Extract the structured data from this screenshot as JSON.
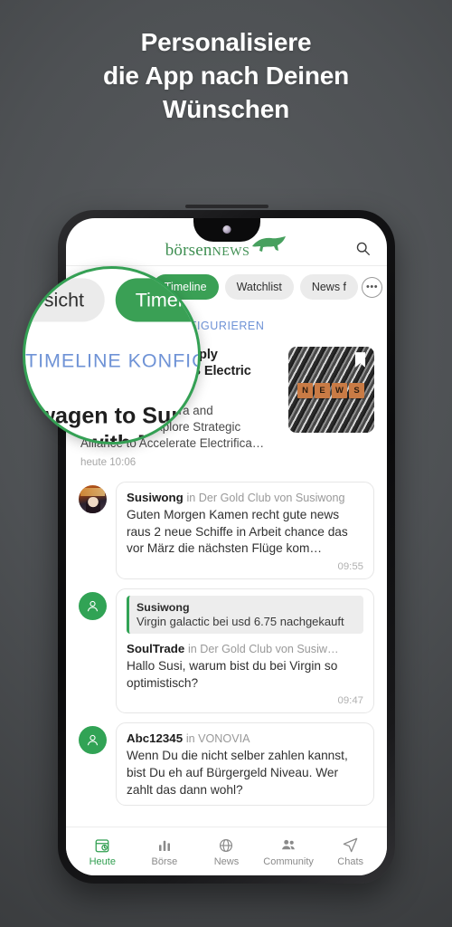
{
  "promo": {
    "line1": "Personalisiere",
    "line2": "die App nach Deinen",
    "line3": "Wünschen"
  },
  "colors": {
    "background": "#4e5154",
    "brand_green": "#3aa055",
    "accent_blue": "#6f93d6",
    "magnifier_ring": "#34a054",
    "text_white": "#ffffff"
  },
  "app": {
    "logo": {
      "part1": "börsen",
      "part2": "NEWS",
      "icon": "bull-icon"
    },
    "search_icon": "search-icon",
    "tabs": [
      {
        "label": "Übersicht",
        "active": false
      },
      {
        "label": "Timeline",
        "active": true
      },
      {
        "label": "Watchlist",
        "active": false
      },
      {
        "label": "News f",
        "active": false
      }
    ],
    "more_label": "•••",
    "config": {
      "icon": "gear-icon",
      "label": "TIMELINE KONFIGURIEREN"
    },
    "news_card": {
      "title": "Volkswagen to Supply Mahindra with MEB Electric Components",
      "summary": "(PLX AI) – Mahindra and Volkswagen Explore Strategic Alliance to Accelerate Electrifica…",
      "time": "heute 10:06",
      "thumb": {
        "alt": "news-scrabble-tiles",
        "tiles": [
          "N",
          "E",
          "W",
          "S"
        ]
      },
      "bookmark_icon": "bookmark-icon"
    },
    "chats": [
      {
        "avatar": "photo",
        "user": "Susiwong",
        "context": "in Der Gold Club von Susiwong",
        "text": "Guten Morgen Kamen recht gute news raus 2 neue Schiffe in Arbeit chance das vor März die nächsten Flüge kom…",
        "time": "09:55"
      },
      {
        "avatar": "person",
        "quote": {
          "name": "Susiwong",
          "text": "Virgin galactic bei usd 6.75 nachgekauft"
        },
        "user": "SoulTrade",
        "context": "in Der Gold Club von Susiw…",
        "text": "Hallo Susi, warum bist du bei Virgin so optimistisch?",
        "time": "09:47"
      },
      {
        "avatar": "person",
        "user": "Abc12345",
        "context": "in VONOVIA",
        "text": "Wenn Du die nicht selber zahlen kannst, bist Du eh auf Bürgergeld Niveau. Wer zahlt das dann wohl?",
        "time": ""
      }
    ],
    "bottom_nav": [
      {
        "label": "Heute",
        "icon": "calendar-clock-icon",
        "active": true
      },
      {
        "label": "Börse",
        "icon": "bar-chart-icon",
        "active": false
      },
      {
        "label": "News",
        "icon": "globe-icon",
        "active": false
      },
      {
        "label": "Community",
        "icon": "people-icon",
        "active": false
      },
      {
        "label": "Chats",
        "icon": "send-icon",
        "active": false
      }
    ]
  },
  "magnifier": {
    "tabs": [
      {
        "label": "Übersicht",
        "active": false
      },
      {
        "label": "Timeline",
        "active": true
      }
    ],
    "config_label": "TIMELINE KONFIGURIEREN",
    "news_title": "Volkswagen to Supply Mahindra with MEB Electric Components"
  }
}
